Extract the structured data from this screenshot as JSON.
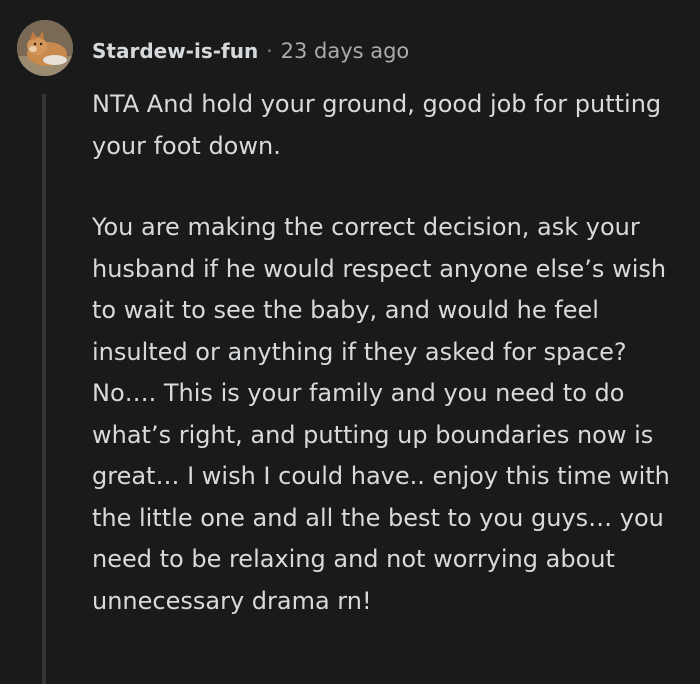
{
  "comment": {
    "author": "Stardew-is-fun",
    "separator": "·",
    "timestamp": "23 days ago",
    "avatar_icon": "dog-avatar-icon",
    "paragraphs": [
      "NTA And hold your ground, good job for putting your foot down.",
      "You are making the correct decision, ask your husband if he would respect anyone else’s wish to wait to see the baby, and would he feel insulted or anything if they asked for space? No…. This is your family and you need to do what’s right, and putting up boundaries now is great… I wish I could have.. enjoy this time with the little one and all the best to you guys… you need to be relaxing and not worrying about unnecessary drama rn!"
    ]
  },
  "colors": {
    "background": "#1a1a1b",
    "text": "#d7dadc",
    "meta": "#a9abad",
    "thread_line": "#343536"
  }
}
